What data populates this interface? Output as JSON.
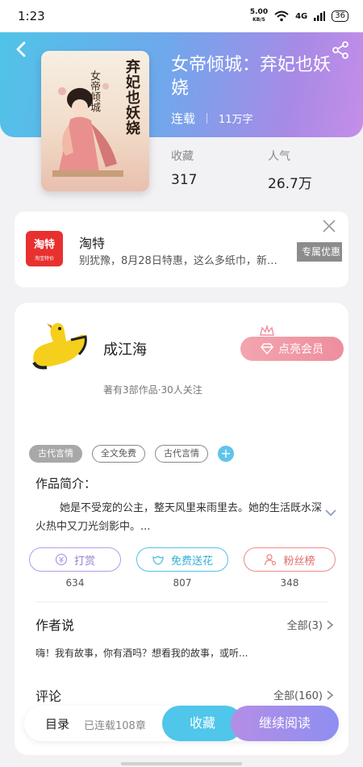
{
  "status_bar": {
    "time": "1:23",
    "speed": "5.00",
    "speed_unit": "KB/S",
    "network": "4G",
    "battery": "36"
  },
  "book": {
    "title": "女帝倾城：弃妃也妖娆",
    "status": "连载",
    "words": "11万字"
  },
  "cover": {
    "title": "弃妃也妖娆",
    "subtitle": "女帝倾城"
  },
  "stats": {
    "collect_label": "收藏",
    "collect_value": "317",
    "popularity_label": "人气",
    "popularity_value": "26.7万"
  },
  "ad": {
    "logo_text": "淘特",
    "logo_sub": "淘宝特价",
    "name": "淘特",
    "desc": "别犹豫，8月28日特惠，这么多纸巾，新…",
    "cta": "专属优惠"
  },
  "author": {
    "name": "成江海",
    "meta": "著有3部作品·30人关注",
    "vip_label": "点亮会员"
  },
  "tags": [
    "古代言情",
    "全文免费",
    "古代言情"
  ],
  "intro": {
    "title": "作品简介：",
    "text": "她是不受宠的公主，整天风里来雨里去。她的生活既水深火热中又刀光剑影中。..."
  },
  "actions": [
    {
      "label": "打赏",
      "count": "634"
    },
    {
      "label": "免费送花",
      "count": "807"
    },
    {
      "label": "粉丝榜",
      "count": "348"
    }
  ],
  "author_said": {
    "title": "作者说",
    "more": "全部(3)",
    "text": "嗨！我有故事，你有酒吗？想看我的故事，或听..."
  },
  "comments": {
    "title": "评论",
    "more": "全部(160)"
  },
  "bottom_bar": {
    "toc": "目录",
    "chapters": "已连载108章",
    "collect": "收藏",
    "read": "继续阅读"
  }
}
